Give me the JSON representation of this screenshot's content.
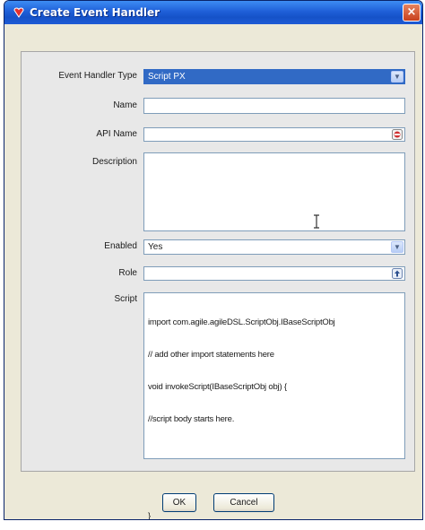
{
  "window": {
    "title": "Create Event Handler",
    "close_glyph": "×"
  },
  "form": {
    "event_handler_type": {
      "label": "Event Handler Type",
      "value": "Script PX"
    },
    "name": {
      "label": "Name",
      "value": ""
    },
    "api_name": {
      "label": "API Name",
      "value": ""
    },
    "description": {
      "label": "Description",
      "value": ""
    },
    "enabled": {
      "label": "Enabled",
      "value": "Yes"
    },
    "role": {
      "label": "Role",
      "value": ""
    },
    "script": {
      "label": "Script",
      "lines": [
        "import com.agile.agileDSL.ScriptObj.IBaseScriptObj",
        "// add other import statements here",
        "void invokeScript(IBaseScriptObj obj) {",
        "//script body starts here.",
        "",
        "",
        "}"
      ]
    }
  },
  "buttons": {
    "ok": "OK",
    "cancel": "Cancel"
  },
  "icons": {
    "title": "app-logo-icon",
    "dropdown": "chevron-down-icon",
    "api_name": "edit-icon",
    "role": "role-picker-icon",
    "cursor": "text-cursor-icon"
  },
  "colors": {
    "titlebar": "#1f5fd8",
    "selection": "#316ac5",
    "field_border": "#7f9db9",
    "close_button": "#c8401c"
  }
}
